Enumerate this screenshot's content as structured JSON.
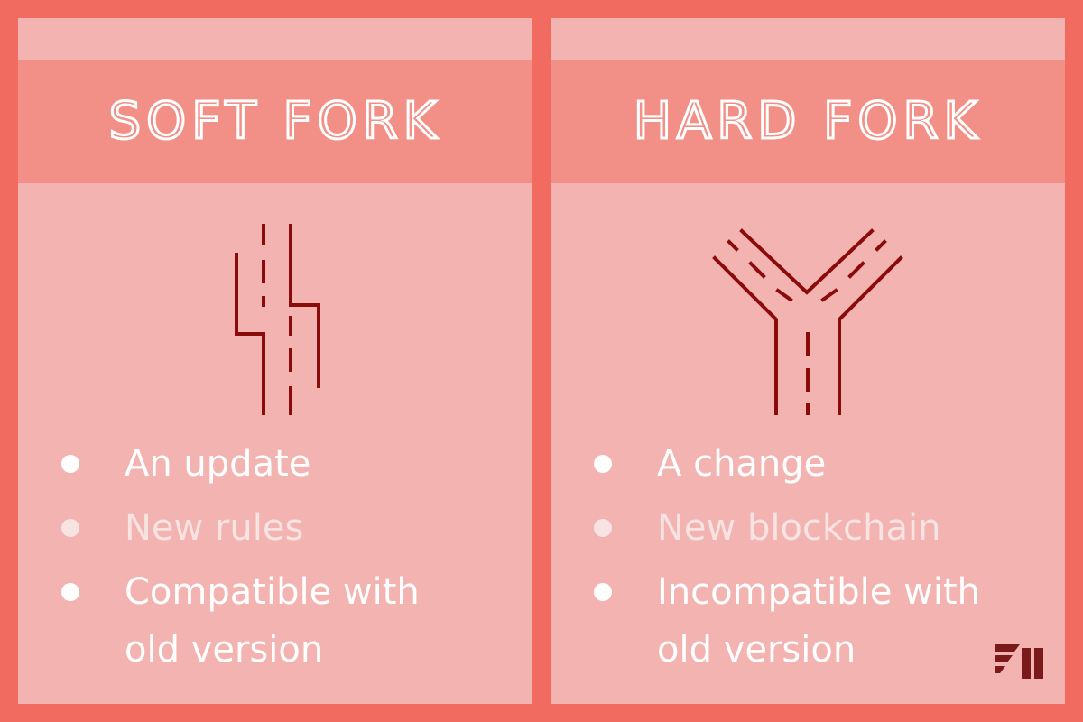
{
  "panels": {
    "soft": {
      "title": "SOFT FORK",
      "bullets": [
        {
          "text": "An update",
          "emphasis": "bright"
        },
        {
          "text": "New rules",
          "emphasis": "faded"
        },
        {
          "text": "Compatible with old version",
          "emphasis": "bright"
        }
      ],
      "icon": "parallel-road-shift-icon"
    },
    "hard": {
      "title": "HARD FORK",
      "bullets": [
        {
          "text": "A change",
          "emphasis": "bright"
        },
        {
          "text": "New blockchain",
          "emphasis": "faded"
        },
        {
          "text": "Incompatible with old version",
          "emphasis": "bright"
        }
      ],
      "icon": "forking-road-y-icon"
    }
  },
  "colors": {
    "background": "#f26b60",
    "panel": "#f2b3b1",
    "title_band": "#f28f86",
    "icon_stroke": "#8b0a0a",
    "bullet_bright": "#ffffff",
    "bullet_faded": "#f7e3e2"
  },
  "logo_icon": "brand-logo-icon"
}
